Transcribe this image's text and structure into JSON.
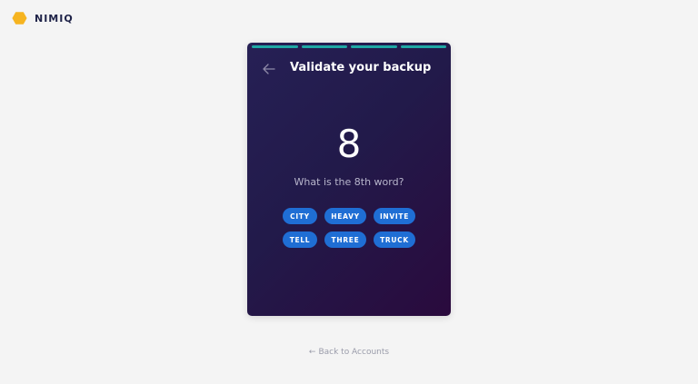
{
  "brand": {
    "name": "NIMIQ",
    "logo_icon": "hexagon-icon",
    "logo_color": "#f6b420"
  },
  "card": {
    "progress_segments": 4,
    "progress_color": "#1fa8a5",
    "back_icon": "arrow-left-icon",
    "title": "Validate your backup",
    "word_number": "8",
    "question": "What is the 8th word?",
    "words": [
      "CITY",
      "HEAVY",
      "INVITE",
      "TELL",
      "THREE",
      "TRUCK"
    ],
    "word_button_color": "#1f6ed4"
  },
  "footer": {
    "back_link_arrow": "←",
    "back_link_label": "Back to Accounts"
  }
}
